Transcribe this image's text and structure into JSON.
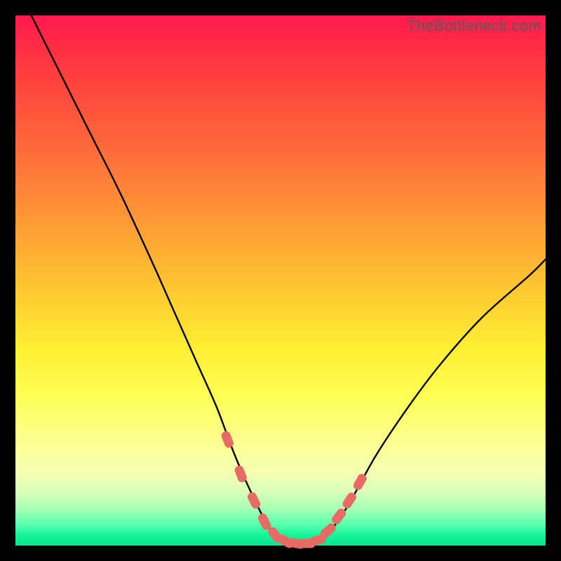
{
  "watermark": "TheBottleneck.com",
  "chart_data": {
    "type": "line",
    "title": "",
    "xlabel": "",
    "ylabel": "",
    "xlim": [
      0,
      100
    ],
    "ylim": [
      0,
      100
    ],
    "series": [
      {
        "name": "bottleneck-curve",
        "x": [
          3,
          8,
          14,
          20,
          26,
          30,
          34,
          38,
          41,
          44,
          47.5,
          50,
          52,
          55,
          58,
          60,
          63,
          68,
          74,
          80,
          88,
          97,
          100
        ],
        "values": [
          100,
          90,
          78,
          66,
          53,
          44,
          35,
          26,
          18,
          11,
          4,
          1.2,
          0.4,
          0.3,
          1.2,
          3.5,
          8,
          17,
          26,
          34,
          43,
          51,
          54
        ]
      },
      {
        "name": "highlight-markers",
        "x": [
          40,
          42.5,
          45,
          47,
          49,
          51,
          53,
          55,
          57,
          59,
          61,
          63,
          65
        ],
        "values": [
          20,
          13.5,
          8.5,
          4.5,
          2,
          0.8,
          0.4,
          0.4,
          1,
          2.8,
          5.5,
          8.5,
          12
        ]
      }
    ],
    "colors": {
      "curve": "#000000",
      "marker": "#e76a64"
    }
  }
}
